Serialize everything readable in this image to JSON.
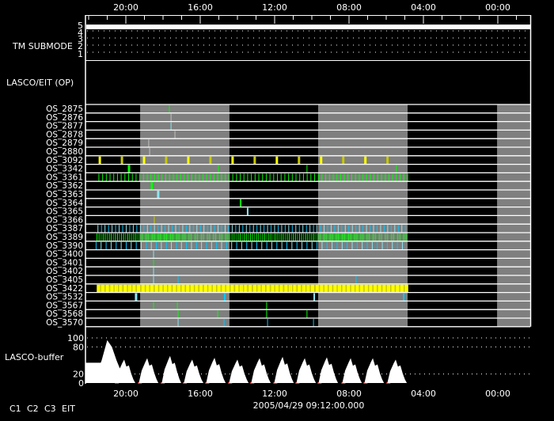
{
  "chart_data": {
    "type": "timeline",
    "x_unit": "hours of day (time runs right-to-left)",
    "x_range": [
      22.17,
      -1.74
    ],
    "x_ticks": [
      {
        "hour": 20,
        "label": "20:00"
      },
      {
        "hour": 16,
        "label": "16:00"
      },
      {
        "hour": 12,
        "label": "12:00"
      },
      {
        "hour": 8,
        "label": "08:00"
      },
      {
        "hour": 4,
        "label": "04:00"
      },
      {
        "hour": 0,
        "label": "00:00"
      }
    ],
    "date_label": "2005/04/29 09:12:00.000",
    "shaded_intervals": [
      [
        19.23,
        14.43
      ],
      [
        9.66,
        4.85
      ],
      [
        0.04,
        -1.74
      ]
    ],
    "tm_submode": {
      "label": "TM SUBMODE",
      "levels": [
        "5",
        "4",
        "3",
        "2",
        "1"
      ],
      "value": 5
    },
    "op_panel": {
      "label": "LASCO/EIT (OP)"
    },
    "colors": {
      "C1": "#ff2020",
      "C2": "#00ff00",
      "C3": "#8ae6f2",
      "C3b": "#00c8ff",
      "EIT": "#ffff00",
      "EITb": "#c8c800",
      "gray": "#c0c0c0"
    },
    "rows": [
      {
        "name": "OS_2875",
        "events": [
          {
            "h": 17.66,
            "c": "C2"
          }
        ]
      },
      {
        "name": "OS_2876",
        "events": [
          {
            "h": 17.57,
            "c": "gray"
          }
        ]
      },
      {
        "name": "OS_2877",
        "events": [
          {
            "h": 17.57,
            "c": "C3"
          }
        ]
      },
      {
        "name": "OS_2878",
        "events": [
          {
            "h": 17.36,
            "c": "gray"
          }
        ]
      },
      {
        "name": "OS_2879",
        "events": [
          {
            "h": 18.77,
            "c": "gray"
          }
        ]
      },
      {
        "name": "OS_2880",
        "events": [
          {
            "h": 18.72,
            "c": "gray"
          }
        ]
      },
      {
        "name": "OS_3092",
        "periodic": {
          "start": 21.4,
          "end": 5.8,
          "step": 1.19,
          "colors": [
            "EIT",
            "EITb"
          ],
          "w": 3
        }
      },
      {
        "name": "OS_3342",
        "events": [
          {
            "h": 19.83,
            "c": "C2",
            "w": 3
          },
          {
            "h": 15.02,
            "c": "C2"
          },
          {
            "h": 10.26,
            "c": "C2"
          },
          {
            "h": 5.45,
            "c": "C2"
          }
        ]
      },
      {
        "name": "OS_3361",
        "periodic": {
          "start": 21.45,
          "end": 4.85,
          "step": 0.2,
          "colors": [
            "C2"
          ],
          "w": 1
        }
      },
      {
        "name": "OS_3362",
        "events": [
          {
            "h": 18.6,
            "c": "C2",
            "w": 3
          }
        ]
      },
      {
        "name": "OS_3363",
        "events": [
          {
            "h": 18.26,
            "c": "C3",
            "w": 3
          }
        ]
      },
      {
        "name": "OS_3364",
        "events": [
          {
            "h": 13.83,
            "c": "C2",
            "w": 2
          }
        ]
      },
      {
        "name": "OS_3365",
        "events": [
          {
            "h": 13.45,
            "c": "C3",
            "w": 2
          }
        ]
      },
      {
        "name": "OS_3366",
        "events": [
          {
            "h": 18.47,
            "c": "EITb"
          }
        ]
      },
      {
        "name": "OS_3387",
        "periodic": {
          "start": 21.5,
          "end": 4.9,
          "step": 0.19,
          "colors": [
            "C3",
            "C3b"
          ],
          "w": 1
        }
      },
      {
        "name": "OS_3389",
        "periodic": {
          "start": 21.55,
          "end": 4.85,
          "step": 0.11,
          "colors": [
            "C2",
            "C2",
            "C2b"
          ],
          "w": 1
        }
      },
      {
        "name": "OS_3390",
        "periodic": {
          "start": 21.6,
          "end": 4.9,
          "step": 0.27,
          "colors": [
            "C3b",
            "C3"
          ],
          "w": 1
        }
      },
      {
        "name": "OS_3400",
        "events": [
          {
            "h": 18.51,
            "c": "C3"
          }
        ]
      },
      {
        "name": "OS_3401",
        "events": [
          {
            "h": 18.51,
            "c": "C2"
          }
        ]
      },
      {
        "name": "OS_3402",
        "events": [
          {
            "h": 18.51,
            "c": "C3"
          }
        ]
      },
      {
        "name": "OS_3405",
        "events": [
          {
            "h": 18.51,
            "c": "C3"
          },
          {
            "h": 17.19,
            "c": "C3b"
          },
          {
            "h": 7.62,
            "c": "C3b"
          }
        ]
      },
      {
        "name": "OS_3422",
        "periodic": {
          "start": 21.53,
          "end": 4.85,
          "step": 0.06,
          "colors": [
            "EIT",
            "EIT",
            "EIT",
            "EITb"
          ],
          "w": 1.6
        }
      },
      {
        "name": "OS_3532",
        "events": [
          {
            "h": 19.45,
            "c": "C3",
            "w": 3
          },
          {
            "h": 14.68,
            "c": "C3b",
            "w": 2
          },
          {
            "h": 9.87,
            "c": "C3",
            "w": 2
          },
          {
            "h": 5.06,
            "c": "C3b",
            "w": 2
          }
        ]
      },
      {
        "name": "OS_3567",
        "events": [
          {
            "h": 18.51,
            "c": "C2"
          },
          {
            "h": 17.23,
            "c": "C2"
          },
          {
            "h": 12.43,
            "c": "C2"
          }
        ]
      },
      {
        "name": "OS_3568",
        "events": [
          {
            "h": 17.19,
            "c": "C2"
          },
          {
            "h": 15.06,
            "c": "C2"
          },
          {
            "h": 12.43,
            "c": "C2"
          },
          {
            "h": 10.26,
            "c": "C2"
          }
        ]
      },
      {
        "name": "OS_3570",
        "events": [
          {
            "h": 17.19,
            "c": "C3"
          },
          {
            "h": 14.72,
            "c": "C3b"
          },
          {
            "h": 12.38,
            "c": "C3b"
          },
          {
            "h": 9.91,
            "c": "C3b"
          }
        ]
      }
    ],
    "buffer": {
      "label": "LASCO-buffer",
      "ylim": [
        0,
        100
      ],
      "y_ticks": [
        "100",
        "80",
        "20",
        "0"
      ],
      "y_tick_values": [
        100,
        80,
        20,
        0
      ],
      "dotted_levels": [
        100,
        80,
        20
      ],
      "initial": [
        [
          22.17,
          45
        ],
        [
          21.35,
          45
        ],
        [
          21.3,
          50
        ],
        [
          21.0,
          95
        ],
        [
          20.75,
          80
        ],
        [
          20.5,
          50
        ],
        [
          20.2,
          20
        ],
        [
          19.9,
          5
        ],
        [
          19.7,
          0
        ]
      ],
      "humps": [
        {
          "peak": 20.09,
          "value": 52
        },
        {
          "peak": 18.85,
          "value": 55
        },
        {
          "peak": 17.62,
          "value": 60
        },
        {
          "peak": 16.43,
          "value": 52
        },
        {
          "peak": 15.23,
          "value": 56
        },
        {
          "peak": 14.0,
          "value": 52
        },
        {
          "peak": 12.81,
          "value": 55
        },
        {
          "peak": 11.57,
          "value": 58
        },
        {
          "peak": 10.38,
          "value": 55
        },
        {
          "peak": 9.19,
          "value": 57
        },
        {
          "peak": 7.91,
          "value": 55
        },
        {
          "peak": 6.72,
          "value": 55
        },
        {
          "peak": 5.49,
          "value": 52
        }
      ]
    },
    "legend": [
      {
        "label": "C1",
        "color": "#ff2020"
      },
      {
        "label": "C2",
        "color": "#00ff00"
      },
      {
        "label": "C3",
        "color": "#8ae6f2"
      },
      {
        "label": "EIT",
        "color": "#ffff00"
      }
    ]
  }
}
